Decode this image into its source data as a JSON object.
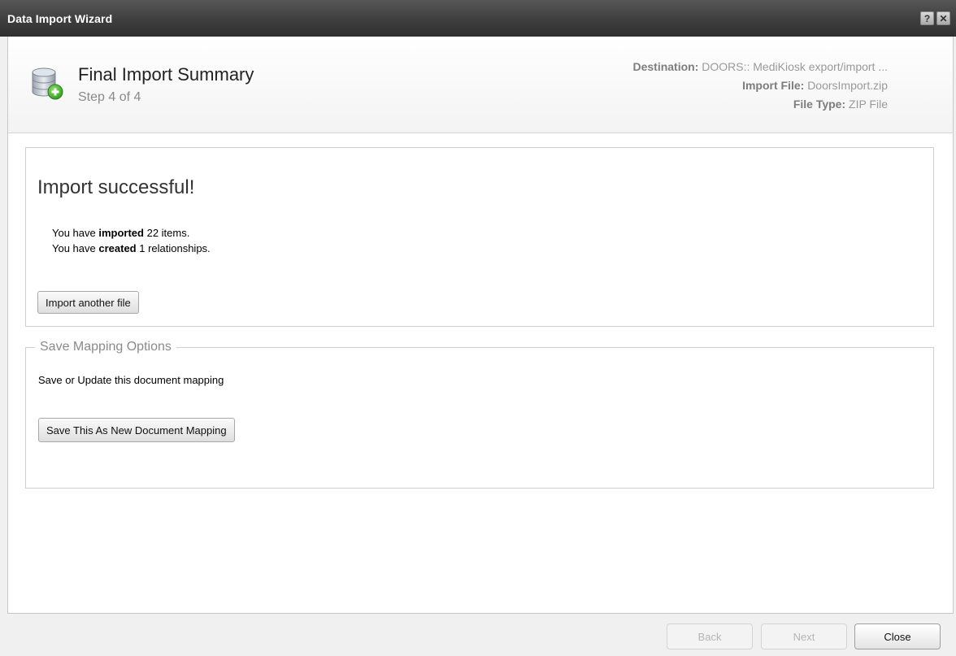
{
  "window": {
    "title": "Data Import Wizard",
    "help_icon": "question-icon",
    "help_label": "?",
    "close_icon": "close-icon",
    "close_label": "✕"
  },
  "header": {
    "icon": "database-add-icon",
    "title": "Final Import Summary",
    "step": "Step 4 of 4",
    "destination_label": "Destination:",
    "destination_value": "DOORS:: MediKiosk export/import ...",
    "import_file_label": "Import File:",
    "import_file_value": "DoorsImport.zip",
    "file_type_label": "File Type:",
    "file_type_value": "ZIP File"
  },
  "result": {
    "title": "Import successful!",
    "line1_pre": "You have ",
    "line1_bold": "imported",
    "line1_post": " 22 items.",
    "line2_pre": "You have ",
    "line2_bold": "created",
    "line2_post": " 1 relationships.",
    "import_another_label": "Import another file"
  },
  "mapping": {
    "legend": "Save Mapping Options",
    "description": "Save or Update this document mapping",
    "save_label": "Save This As New Document Mapping"
  },
  "footer": {
    "back_label": "Back",
    "next_label": "Next",
    "close_label": "Close"
  }
}
